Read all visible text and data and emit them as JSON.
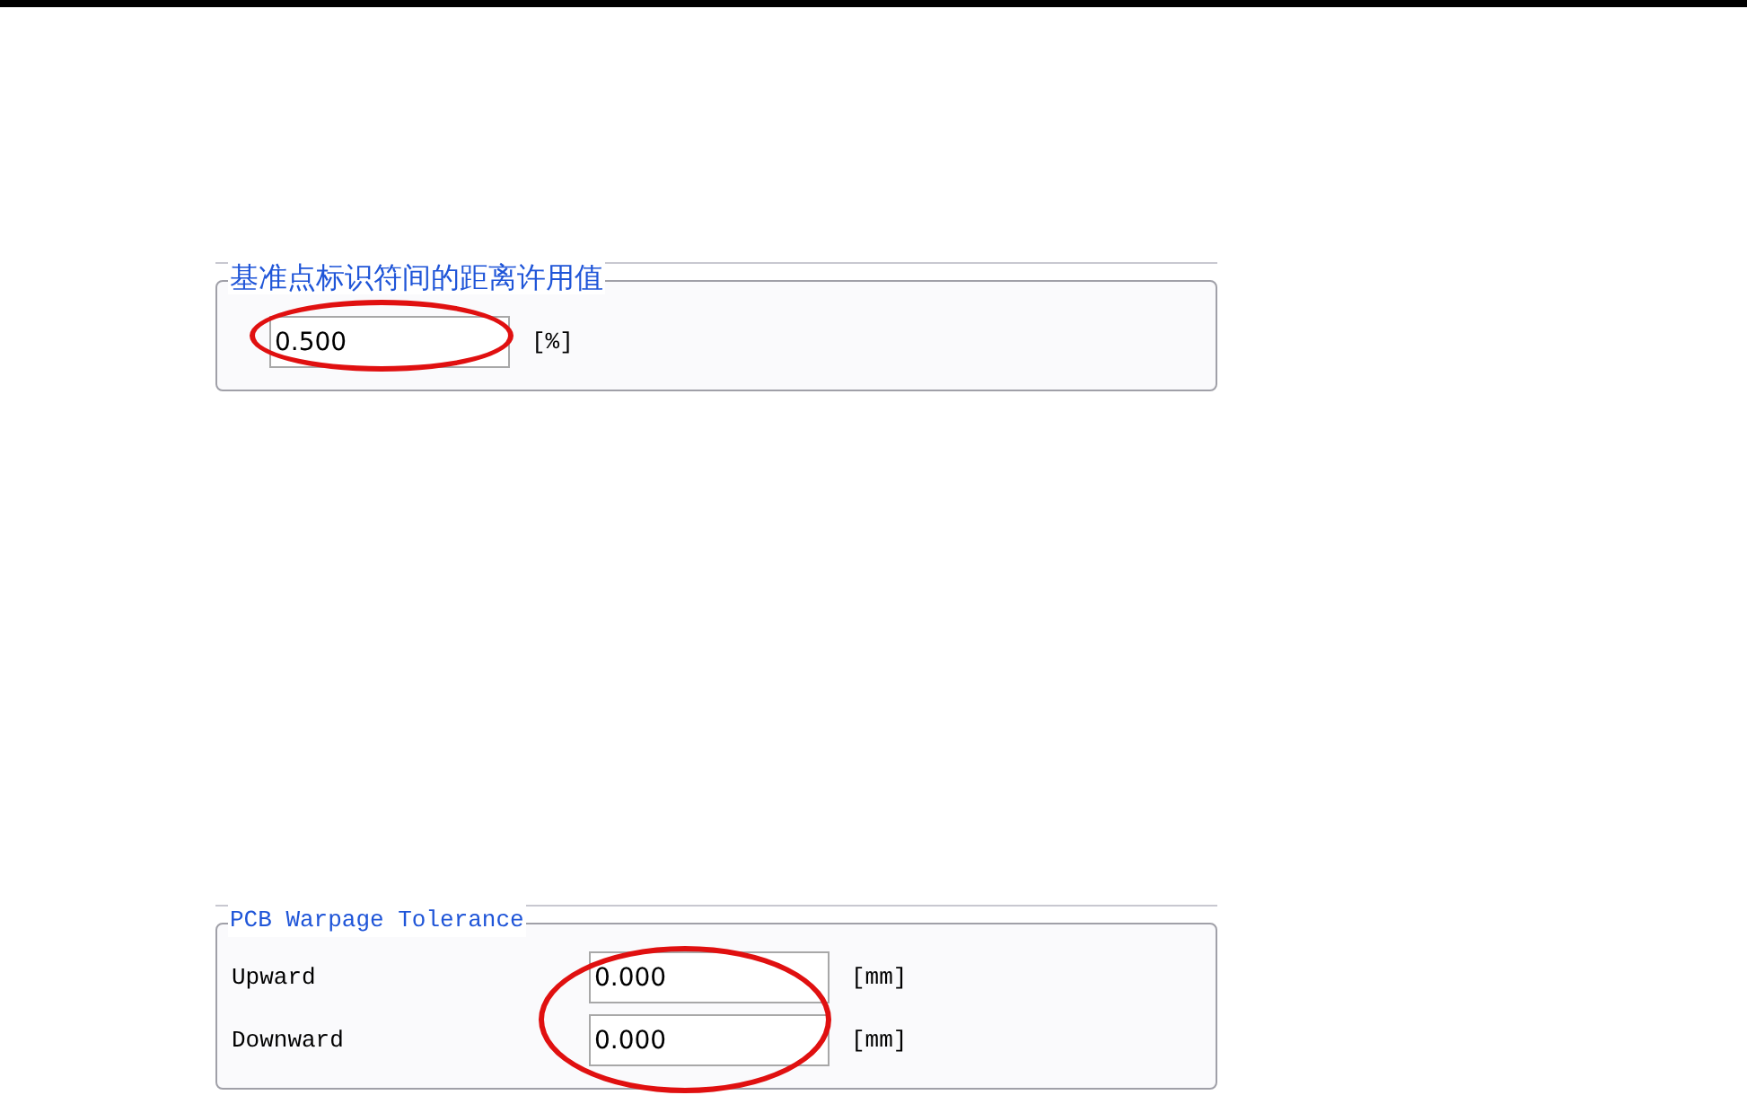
{
  "panels": [
    {
      "title": "基准点标识符间的距离许用值",
      "mono": false,
      "circled": true,
      "fields": [
        {
          "value": "0.500",
          "unit": "[%]"
        }
      ]
    },
    {
      "title": "PCB Warpage Tolerance",
      "mono": true,
      "circled": true,
      "fields": [
        {
          "label": "Upward",
          "value": "0.000",
          "unit": "[mm]"
        },
        {
          "label": "Downward",
          "value": "0.000",
          "unit": "[mm]"
        }
      ]
    }
  ]
}
